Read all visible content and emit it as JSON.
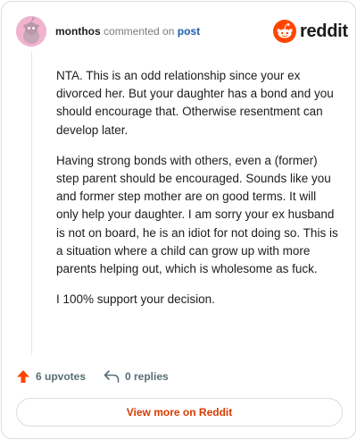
{
  "header": {
    "author": "monthos",
    "verb": "commented on",
    "post_link": "post",
    "brand": "reddit"
  },
  "comment": {
    "paragraphs": [
      "NTA. This is an odd relationship since your ex divorced her. But your daughter has a bond and you should encourage that. Otherwise resentment can develop later.",
      "Having strong bonds with others, even a (former) step parent should be encouraged. Sounds like you and former step mother are on good terms. It will only help your daughter. I am sorry your ex husband is not on board, he is an idiot for not doing so. This is a situation where a child can grow up with more parents helping out, which is wholesome as fuck.",
      "I 100% support your decision."
    ]
  },
  "actions": {
    "upvotes": "6 upvotes",
    "replies": "0 replies",
    "view_more": "View more on Reddit"
  },
  "colors": {
    "accent": "#ff4500",
    "link": "#1a5fb4",
    "view_more_text": "#d93a00",
    "avatar_bg": "#f1b3cf"
  },
  "icons": {
    "avatar": "snoo-avatar-icon",
    "brand": "reddit-logo-icon",
    "upvote": "upvote-arrow-icon",
    "reply": "reply-arrow-icon"
  }
}
